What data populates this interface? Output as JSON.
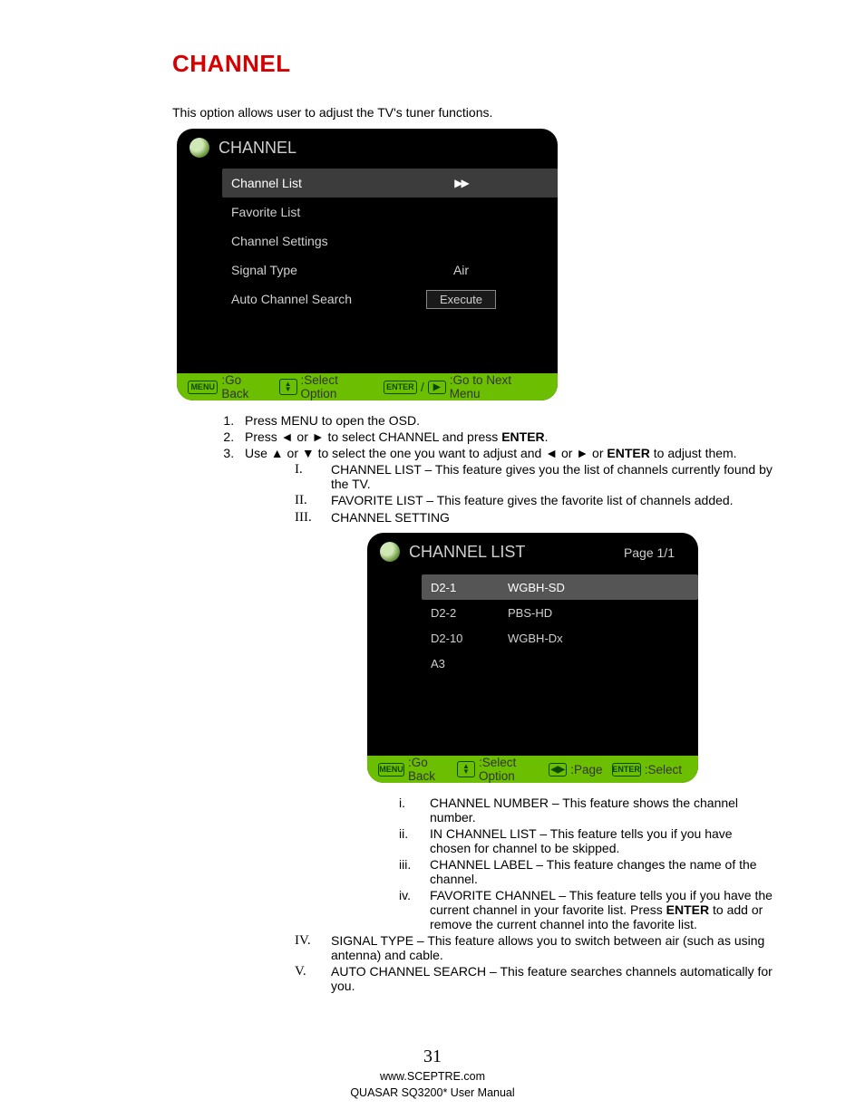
{
  "heading": "CHANNEL",
  "intro": "This option allows user to adjust the TV's tuner functions.",
  "osd_main": {
    "title": "CHANNEL",
    "rows": [
      {
        "label": "Channel List",
        "value": "",
        "selected": true,
        "arrows": "▶▶"
      },
      {
        "label": "Favorite List",
        "value": ""
      },
      {
        "label": "Channel Settings",
        "value": ""
      },
      {
        "label": "Signal Type",
        "value": "Air"
      },
      {
        "label": "Auto Channel Search",
        "button": "Execute"
      }
    ],
    "footer": {
      "menu": "MENU",
      "go_back": ":Go Back",
      "select_opt": ":Select Option",
      "enter": "ENTER",
      "next_menu": ":Go to Next Menu"
    }
  },
  "steps": {
    "s1": "Press MENU to open the OSD.",
    "s2a": "Press ◄ or ► to select CHANNEL and press ",
    "s2b": "ENTER",
    "s2c": ".",
    "s3a": "Use ▲ or ▼ to select the one you want to adjust and ◄ or ► or ",
    "s3b": "ENTER",
    "s3c": " to adjust them."
  },
  "sub1": {
    "i": "CHANNEL LIST – This feature gives you the list of channels currently found by the TV.",
    "ii": "FAVORITE LIST – This feature gives the favorite list of channels added.",
    "iii": "CHANNEL SETTING"
  },
  "osd_list": {
    "title": "CHANNEL LIST",
    "page": "Page 1/1",
    "rows": [
      {
        "ch": "D2-1",
        "name": "WGBH-SD",
        "selected": true
      },
      {
        "ch": "D2-2",
        "name": "PBS-HD"
      },
      {
        "ch": "D2-10",
        "name": "WGBH-Dx"
      },
      {
        "ch": "A3",
        "name": ""
      }
    ],
    "footer": {
      "menu": "MENU",
      "go_back": ":Go Back",
      "select_opt": ":Select Option",
      "page": ":Page",
      "enter": "ENTER",
      "select": ":Select"
    }
  },
  "sub2": {
    "i": "CHANNEL NUMBER – This feature shows the channel number.",
    "ii": "IN CHANNEL LIST – This feature tells you if you have chosen for channel to be skipped.",
    "iii": "CHANNEL LABEL – This feature changes the name of the channel.",
    "iv_a": "FAVORITE CHANNEL – This feature tells you if you have the current channel in your favorite list. Press ",
    "iv_b": "ENTER",
    "iv_c": " to add or remove the current channel into the favorite list."
  },
  "sub3": {
    "iv": "SIGNAL TYPE – This feature allows you to switch between air (such as using antenna) and cable.",
    "v": "AUTO CHANNEL SEARCH – This feature searches channels automatically for you."
  },
  "footer": {
    "page_no": "31",
    "url": "www.SCEPTRE.com",
    "model": "QUASAR SQ3200* User Manual"
  }
}
